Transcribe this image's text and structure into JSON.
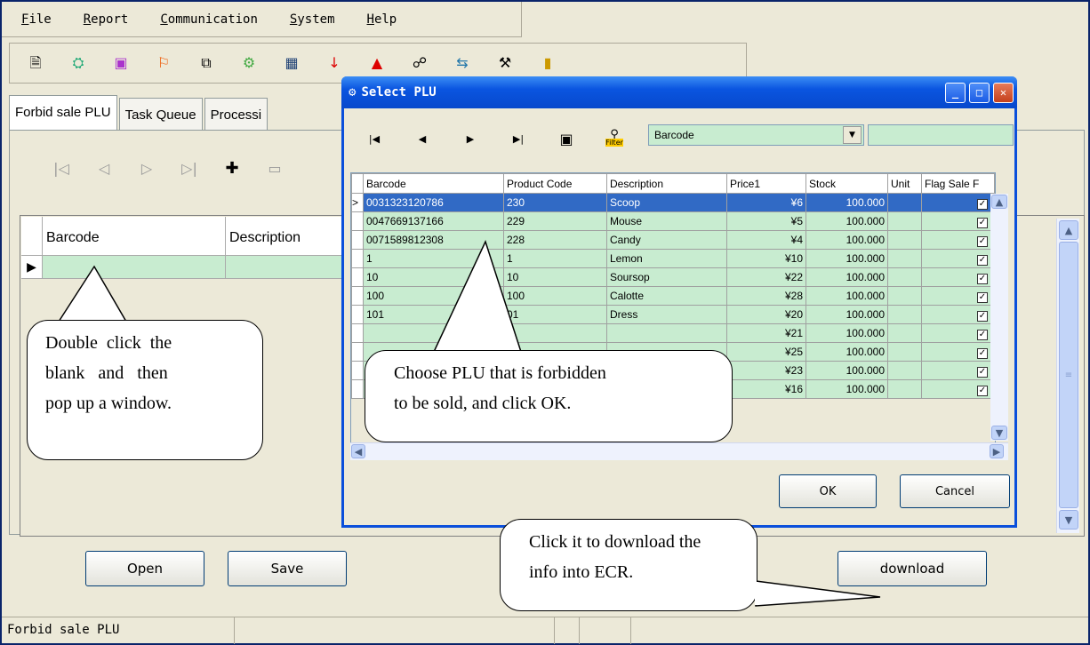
{
  "menu": [
    "File",
    "Report",
    "Communication",
    "System",
    "Help"
  ],
  "menu_underline": [
    "F",
    "R",
    "C",
    "S",
    "H"
  ],
  "toolbar_icons": [
    "new-icon",
    "customer-icon",
    "report-icon",
    "run-icon",
    "copy-icon",
    "settings-icon",
    "table-icon",
    "download-icon",
    "upload-icon",
    "network-icon",
    "exchange-icon",
    "tools-icon",
    "exit-icon"
  ],
  "tabs": [
    "Forbid sale PLU",
    "Task Queue",
    "Processi"
  ],
  "nav_buttons": [
    "first",
    "prev",
    "next",
    "last",
    "add",
    "delete"
  ],
  "grid": {
    "columns": [
      "Barcode",
      "Description"
    ]
  },
  "buttons": {
    "open": "Open",
    "save": "Save",
    "download": "download"
  },
  "status": {
    "text": "Forbid sale PLU"
  },
  "dialog": {
    "title": "Select PLU",
    "combo_value": "Barcode",
    "filter_label": "Filter",
    "columns": [
      "Barcode",
      "Product Code",
      "Description",
      "Price1",
      "Stock",
      "Unit",
      "Flag Sale F"
    ],
    "rows": [
      [
        "0031323120786",
        "230",
        "Scoop",
        "¥6",
        "100.000",
        "",
        true
      ],
      [
        "0047669137166",
        "229",
        "Mouse",
        "¥5",
        "100.000",
        "",
        true
      ],
      [
        "0071589812308",
        "228",
        "Candy",
        "¥4",
        "100.000",
        "",
        true
      ],
      [
        "1",
        "1",
        "Lemon",
        "¥10",
        "100.000",
        "",
        true
      ],
      [
        "10",
        "10",
        "Soursop",
        "¥22",
        "100.000",
        "",
        true
      ],
      [
        "100",
        "100",
        "Calotte",
        "¥28",
        "100.000",
        "",
        true
      ],
      [
        "101",
        "01",
        "Dress",
        "¥20",
        "100.000",
        "",
        true
      ],
      [
        "",
        "",
        "",
        "¥21",
        "100.000",
        "",
        true
      ],
      [
        "",
        "",
        "",
        "¥25",
        "100.000",
        "",
        true
      ],
      [
        "",
        "",
        "",
        "¥23",
        "100.000",
        "",
        true
      ],
      [
        "",
        "",
        "",
        "¥16",
        "100.000",
        "",
        true
      ]
    ],
    "ok": "OK",
    "cancel": "Cancel"
  },
  "callouts": {
    "left": "Double click the blank and then pop up a window.",
    "left_lines": [
      "Double  click  the",
      "blank   and   then",
      "pop up a window."
    ],
    "middle_lines": [
      "Choose PLU that is forbidden",
      "to be sold, and click OK."
    ],
    "bottom_lines": [
      "Click it to download the",
      "info into ECR."
    ]
  },
  "colors": {
    "titlebar": "#0a55e0",
    "grid_cell": "#c8ecd0",
    "selected_row": "#316ac5",
    "window_bg": "#ece9d8"
  }
}
